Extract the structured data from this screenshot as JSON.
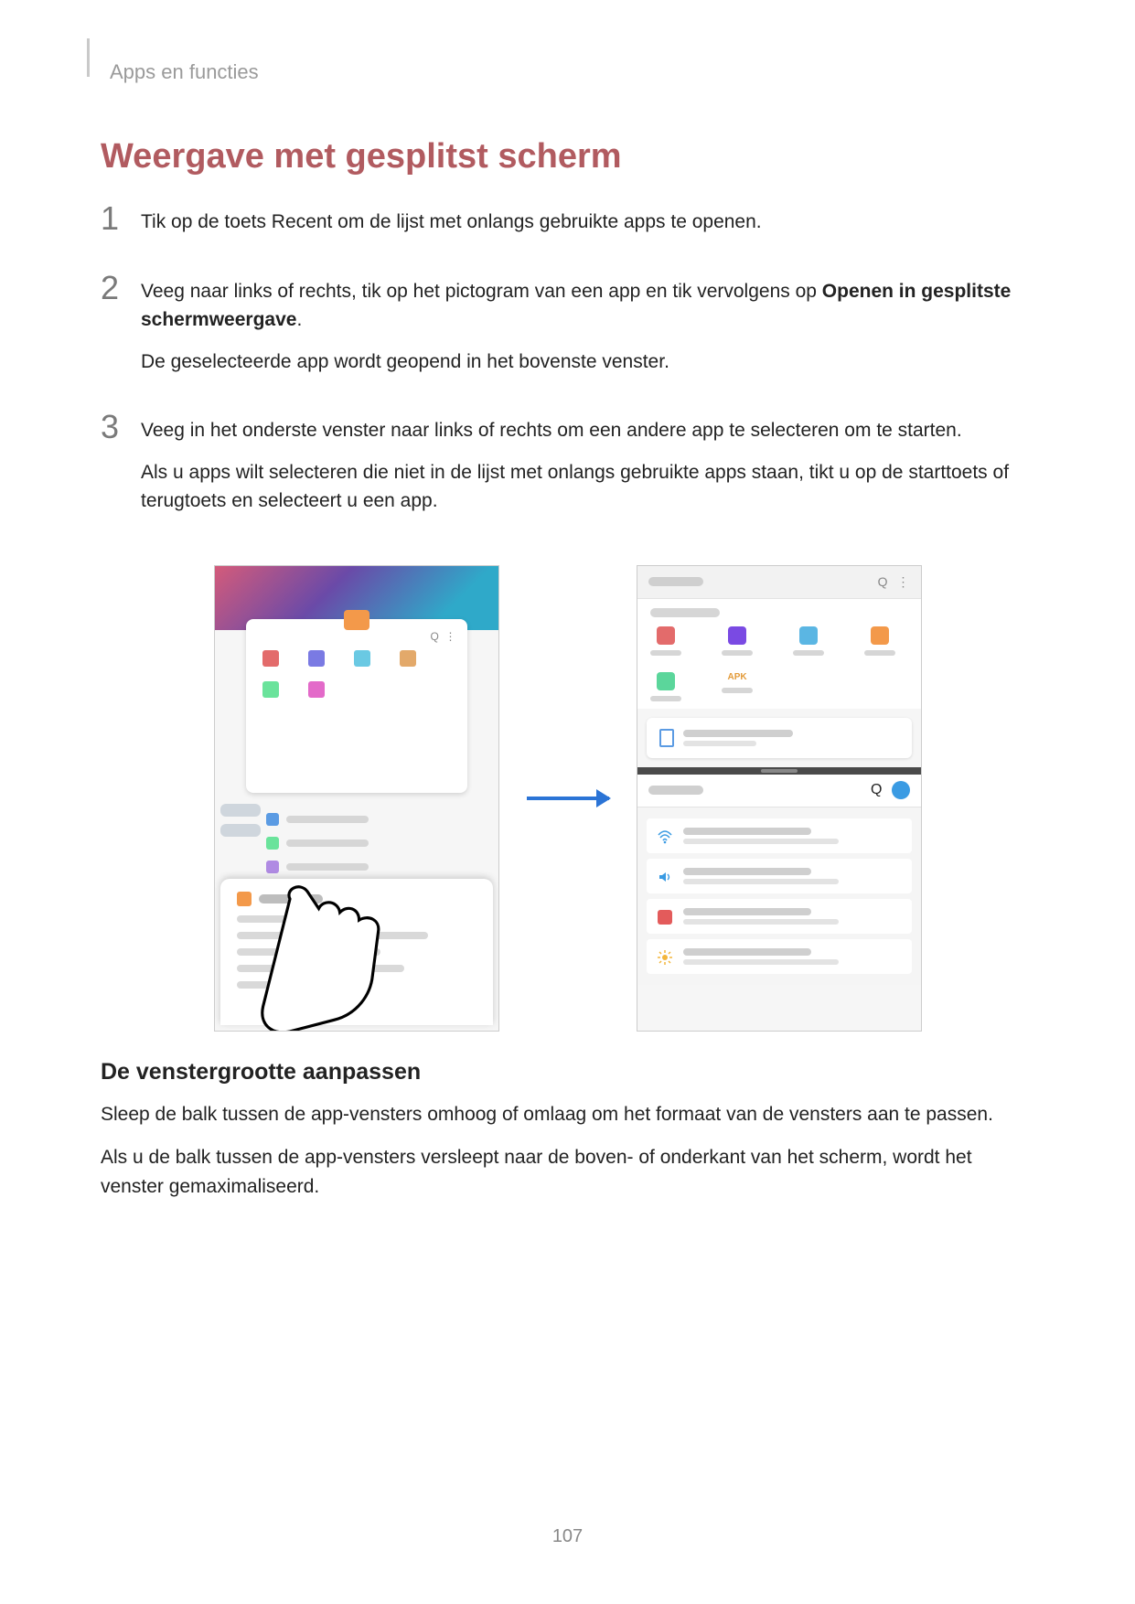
{
  "breadcrumb": "Apps en functies",
  "heading": "Weergave met gesplitst scherm",
  "steps": {
    "s1": {
      "num": "1",
      "text": "Tik op de toets Recent om de lijst met onlangs gebruikte apps te openen."
    },
    "s2": {
      "num": "2",
      "text_a": "Veeg naar links of rechts, tik op het pictogram van een app en tik vervolgens op ",
      "bold": "Openen in gesplitste schermweergave",
      "text_b": ".",
      "sub": "De geselecteerde app wordt geopend in het bovenste venster."
    },
    "s3": {
      "num": "3",
      "text": "Veeg in het onderste venster naar links of rechts om een andere app te selecteren om te starten.",
      "sub": "Als u apps wilt selecteren die niet in de lijst met onlangs gebruikte apps staan, tikt u op de starttoets of terugtoets en selecteert u een app."
    }
  },
  "apk_label": "APK",
  "section2_heading": "De venstergrootte aanpassen",
  "section2_p1": "Sleep de balk tussen de app-vensters omhoog of omlaag om het formaat van de vensters aan te passen.",
  "section2_p2": "Als u de balk tussen de app-vensters versleept naar de boven- of onderkant van het scherm, wordt het venster gemaximaliseerd.",
  "page_number": "107"
}
